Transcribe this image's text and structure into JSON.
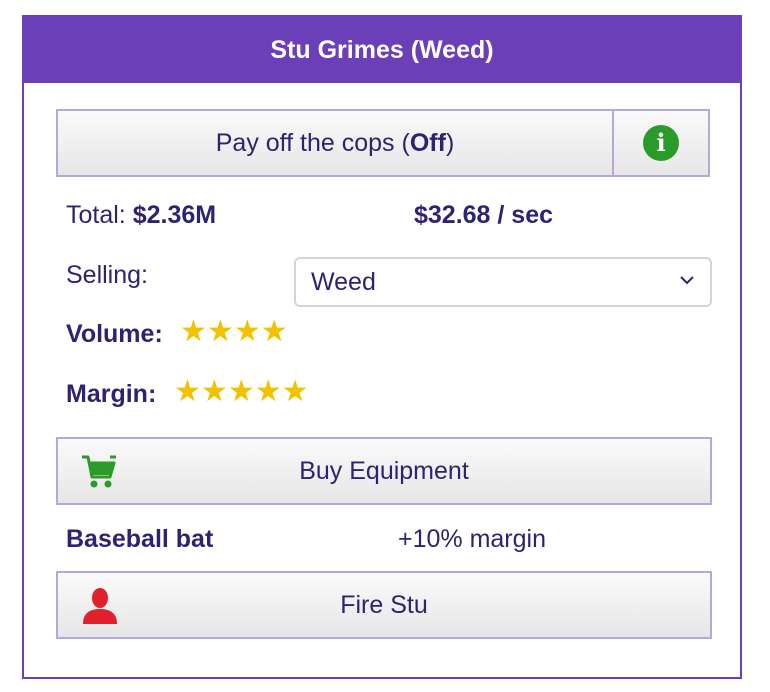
{
  "header": {
    "title": "Stu Grimes (Weed)"
  },
  "cops": {
    "label_prefix": "Pay off the cops (",
    "state": "Off",
    "label_suffix": ")"
  },
  "info": {
    "icon": "info-icon",
    "glyph": "i"
  },
  "stats": {
    "total_label": "Total:",
    "total_value": "$2.36M",
    "rate": "$32.68 / sec"
  },
  "selling": {
    "label": "Selling:",
    "selected": "Weed"
  },
  "volume": {
    "label": "Volume:",
    "stars": 4,
    "max": 4
  },
  "margin": {
    "label": "Margin:",
    "stars": 5,
    "max": 5
  },
  "equipment": {
    "button_label": "Buy Equipment",
    "icon": "cart-icon",
    "item_name": "Baseball bat",
    "item_effect": "+10% margin"
  },
  "fire": {
    "button_label": "Fire Stu",
    "icon": "person-icon"
  },
  "colors": {
    "accent": "#6a3fb8",
    "text": "#2d2373",
    "star": "#f2c200",
    "green": "#2a9a2a",
    "red": "#e0202a"
  }
}
